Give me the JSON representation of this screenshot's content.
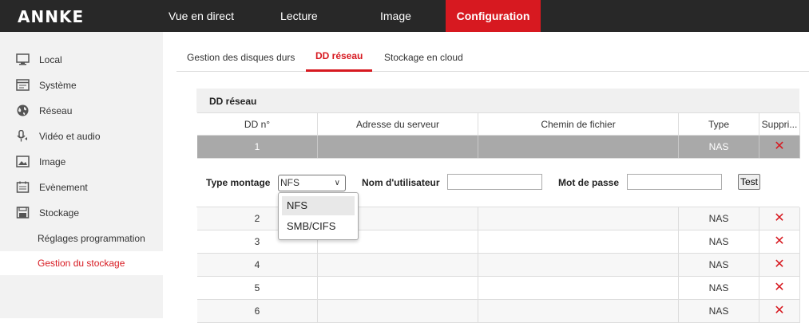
{
  "app": {
    "logo": "ANNKE"
  },
  "topnav": [
    {
      "label": "Vue en direct",
      "active": false
    },
    {
      "label": "Lecture",
      "active": false
    },
    {
      "label": "Image",
      "active": false
    },
    {
      "label": "Configuration",
      "active": true
    }
  ],
  "sidebar": {
    "items": [
      {
        "label": "Local",
        "icon": "monitor-icon"
      },
      {
        "label": "Système",
        "icon": "system-icon"
      },
      {
        "label": "Réseau",
        "icon": "globe-icon"
      },
      {
        "label": "Vidéo et audio",
        "icon": "microphone-icon"
      },
      {
        "label": "Image",
        "icon": "image-icon"
      },
      {
        "label": "Evènement",
        "icon": "calendar-icon"
      },
      {
        "label": "Stockage",
        "icon": "disk-icon"
      }
    ],
    "subitems": [
      {
        "label": "Réglages programmation",
        "active": false
      },
      {
        "label": "Gestion du stockage",
        "active": true
      }
    ]
  },
  "tabs": [
    {
      "label": "Gestion des disques durs",
      "active": false
    },
    {
      "label": "DD réseau",
      "active": true
    },
    {
      "label": "Stockage en cloud",
      "active": false
    }
  ],
  "panel": {
    "title": "DD réseau",
    "columns": [
      "DD n°",
      "Adresse du serveur",
      "Chemin de fichier",
      "Type",
      "Suppri..."
    ],
    "selected_row": {
      "num": "1",
      "address": "",
      "path": "",
      "type": "NAS"
    },
    "rows": [
      {
        "num": "2",
        "address": "",
        "path": "",
        "type": "NAS"
      },
      {
        "num": "3",
        "address": "",
        "path": "",
        "type": "NAS"
      },
      {
        "num": "4",
        "address": "",
        "path": "",
        "type": "NAS"
      },
      {
        "num": "5",
        "address": "",
        "path": "",
        "type": "NAS"
      },
      {
        "num": "6",
        "address": "",
        "path": "",
        "type": "NAS"
      }
    ],
    "delete_icon": "close-icon"
  },
  "form": {
    "mount_label": "Type montage",
    "mount_value": "NFS",
    "user_label": "Nom d'utilisateur",
    "user_value": "",
    "pass_label": "Mot de passe",
    "pass_value": "",
    "test_label": "Test"
  },
  "dropdown": {
    "options": [
      {
        "label": "NFS",
        "highlighted": true
      },
      {
        "label": "SMB/CIFS",
        "highlighted": false
      }
    ]
  },
  "colors": {
    "accent": "#d71920",
    "topbar": "#282828",
    "selected_row": "#a9a9a9"
  }
}
